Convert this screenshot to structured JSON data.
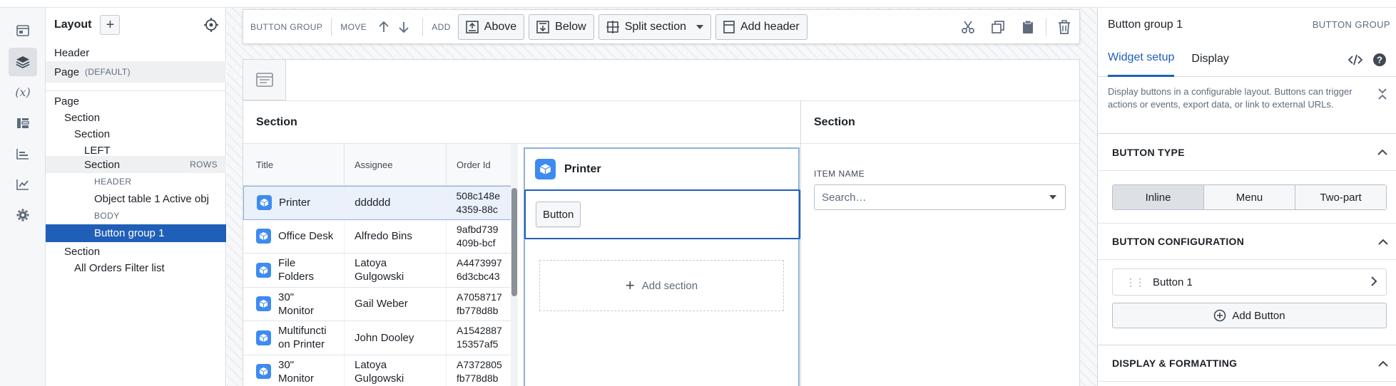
{
  "rail": {
    "items": [
      "app-icon",
      "layers-icon",
      "variables-icon",
      "layout-icon",
      "chart-icon",
      "metrics-icon",
      "settings-icon"
    ],
    "variables_glyph": "(x)"
  },
  "layout_panel": {
    "title": "Layout",
    "header_label": "Header",
    "page_label": "Page",
    "page_default": "(DEFAULT)",
    "tree": {
      "page": "Page",
      "section1": "Section",
      "section2": "Section",
      "left": "LEFT",
      "section3": "Section",
      "rows_tag": "ROWS",
      "header_cap": "HEADER",
      "object_table": "Object table 1 Active obj",
      "body_cap": "BODY",
      "button_group": "Button group 1",
      "section4": "Section",
      "filter_list": "All Orders Filter list"
    }
  },
  "toolbar": {
    "button_group_cap": "BUTTON GROUP",
    "move_cap": "MOVE",
    "add_cap": "ADD",
    "above": "Above",
    "below": "Below",
    "split_section": "Split section",
    "add_header": "Add header"
  },
  "canvas": {
    "section_left_title": "Section",
    "section_right_title": "Section",
    "table": {
      "columns": [
        "Title",
        "Assignee",
        "Order Id"
      ],
      "rows": [
        {
          "title": "Printer",
          "assignee": "dddddd",
          "order": "508c148e\n4359-88c"
        },
        {
          "title": "Office Desk",
          "assignee": "Alfredo Bins",
          "order": "9afbd739\n409b-bcf"
        },
        {
          "title": "File\nFolders",
          "assignee": "Latoya\nGulgowski",
          "order": "A4473997\n6d3cbc43"
        },
        {
          "title": "30\"\nMonitor",
          "assignee": "Gail Weber",
          "order": "A7058717\nfb778d8b"
        },
        {
          "title": "Multifuncti\non Printer",
          "assignee": "John Dooley",
          "order": "A1542887\n15357af5"
        },
        {
          "title": "30\"\nMonitor",
          "assignee": "Latoya\nGulgowski",
          "order": "A7372805\nfb778d8b"
        }
      ]
    },
    "printer_title": "Printer",
    "button_label": "Button",
    "add_section": "Add section",
    "item_name_cap": "ITEM NAME",
    "search_placeholder": "Search…"
  },
  "right_panel": {
    "title": "Button group 1",
    "type_cap": "BUTTON GROUP",
    "tabs": [
      "Widget setup",
      "Display"
    ],
    "description": "Display buttons in a configurable layout. Buttons can trigger actions or events, export data, or link to external URLs.",
    "button_type_heading": "BUTTON TYPE",
    "button_types": [
      "Inline",
      "Menu",
      "Two-part"
    ],
    "selected_type": "Inline",
    "config_heading": "BUTTON CONFIGURATION",
    "button1": "Button 1",
    "add_button": "Add Button",
    "display_heading": "DISPLAY & FORMATTING"
  },
  "colors": {
    "accent": "#1f5fb8",
    "object_icon": "#3d8bf0",
    "selected_row_bg": "#eaf1fb"
  }
}
